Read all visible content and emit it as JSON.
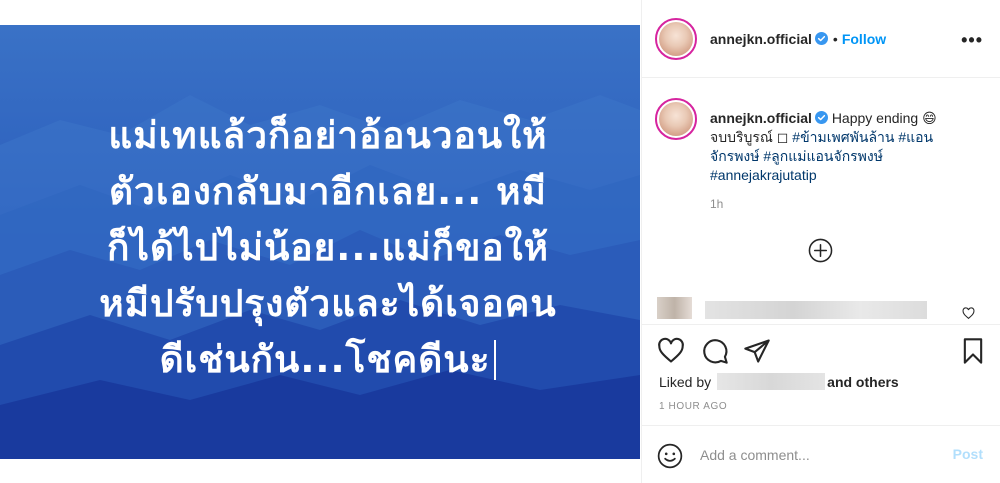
{
  "image": {
    "caption_lines": [
      "แม่เทแล้วก็อย่าอ้อนวอนให้",
      "ตัวเองกลับมาอีกเลย... หมี",
      "ก็ได้ไปไม่น้อย...แม่ก็ขอให้",
      "หมีปรับปรุงตัวและได้เจอคน",
      "ดีเช่นกัน...โชคดีนะ"
    ]
  },
  "header": {
    "username": "annejkn.official",
    "dot": "•",
    "follow_label": "Follow",
    "more_label": "•••"
  },
  "caption": {
    "username": "annejkn.official",
    "text_start": "Happy ending 😄",
    "text_line2": "จบบริบูรณ์ ◻ ",
    "tags": [
      "#ข้ามเพศพันล้าน",
      "#แอน",
      "จักรพงษ์",
      "#ลูกแม่แอนจักรพงษ์",
      "#annejakrajutatip"
    ],
    "time": "1h"
  },
  "likes": {
    "prefix": "Liked by",
    "suffix": "and others"
  },
  "post_time": "1 HOUR AGO",
  "comment_box": {
    "placeholder": "Add a comment...",
    "post_label": "Post"
  },
  "colors": {
    "accent": "#0095f6",
    "post_disabled": "#b2dffc",
    "hashtag": "#00376b",
    "photo_blue": "#2450b8"
  }
}
